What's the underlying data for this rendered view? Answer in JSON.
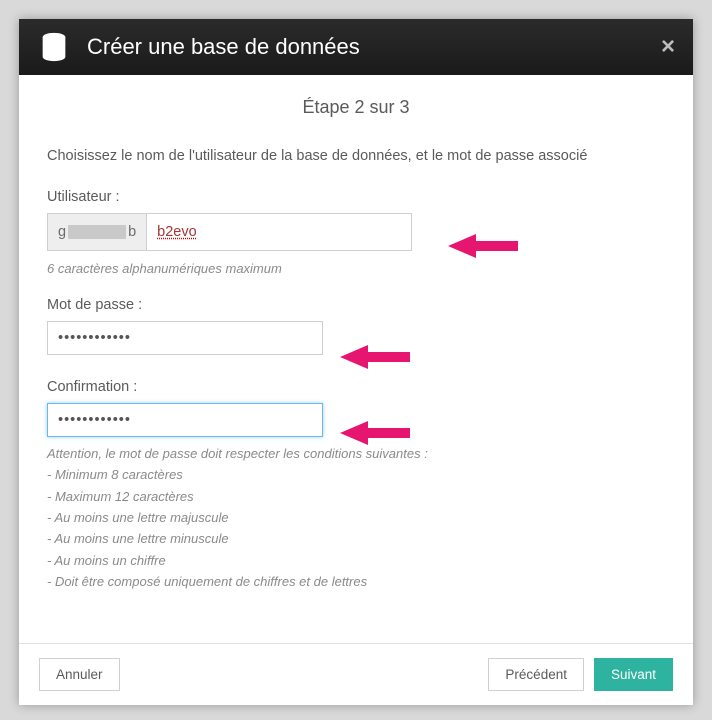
{
  "colors": {
    "accent": "#2fb3a1",
    "arrow": "#e6156f"
  },
  "modal": {
    "title": "Créer une base de données",
    "step": "Étape 2 sur 3",
    "instructions": "Choisissez le nom de l'utilisateur de la base de données, et le mot de passe associé",
    "user": {
      "label": "Utilisateur :",
      "prefix_left": "g",
      "prefix_right": "b",
      "value": "b2evo",
      "hint": "6 caractères alphanumériques maximum"
    },
    "password": {
      "label": "Mot de passe :",
      "value": "••••••••••••"
    },
    "confirm": {
      "label": "Confirmation :",
      "value": "••••••••••••",
      "rules_intro": "Attention, le mot de passe doit respecter les conditions suivantes :",
      "rules": [
        "- Minimum 8 caractères",
        "- Maximum 12 caractères",
        "- Au moins une lettre majuscule",
        "- Au moins une lettre minuscule",
        "- Au moins un chiffre",
        "- Doit être composé uniquement de chiffres et de lettres"
      ]
    },
    "footer": {
      "cancel": "Annuler",
      "previous": "Précédent",
      "next": "Suivant"
    }
  }
}
